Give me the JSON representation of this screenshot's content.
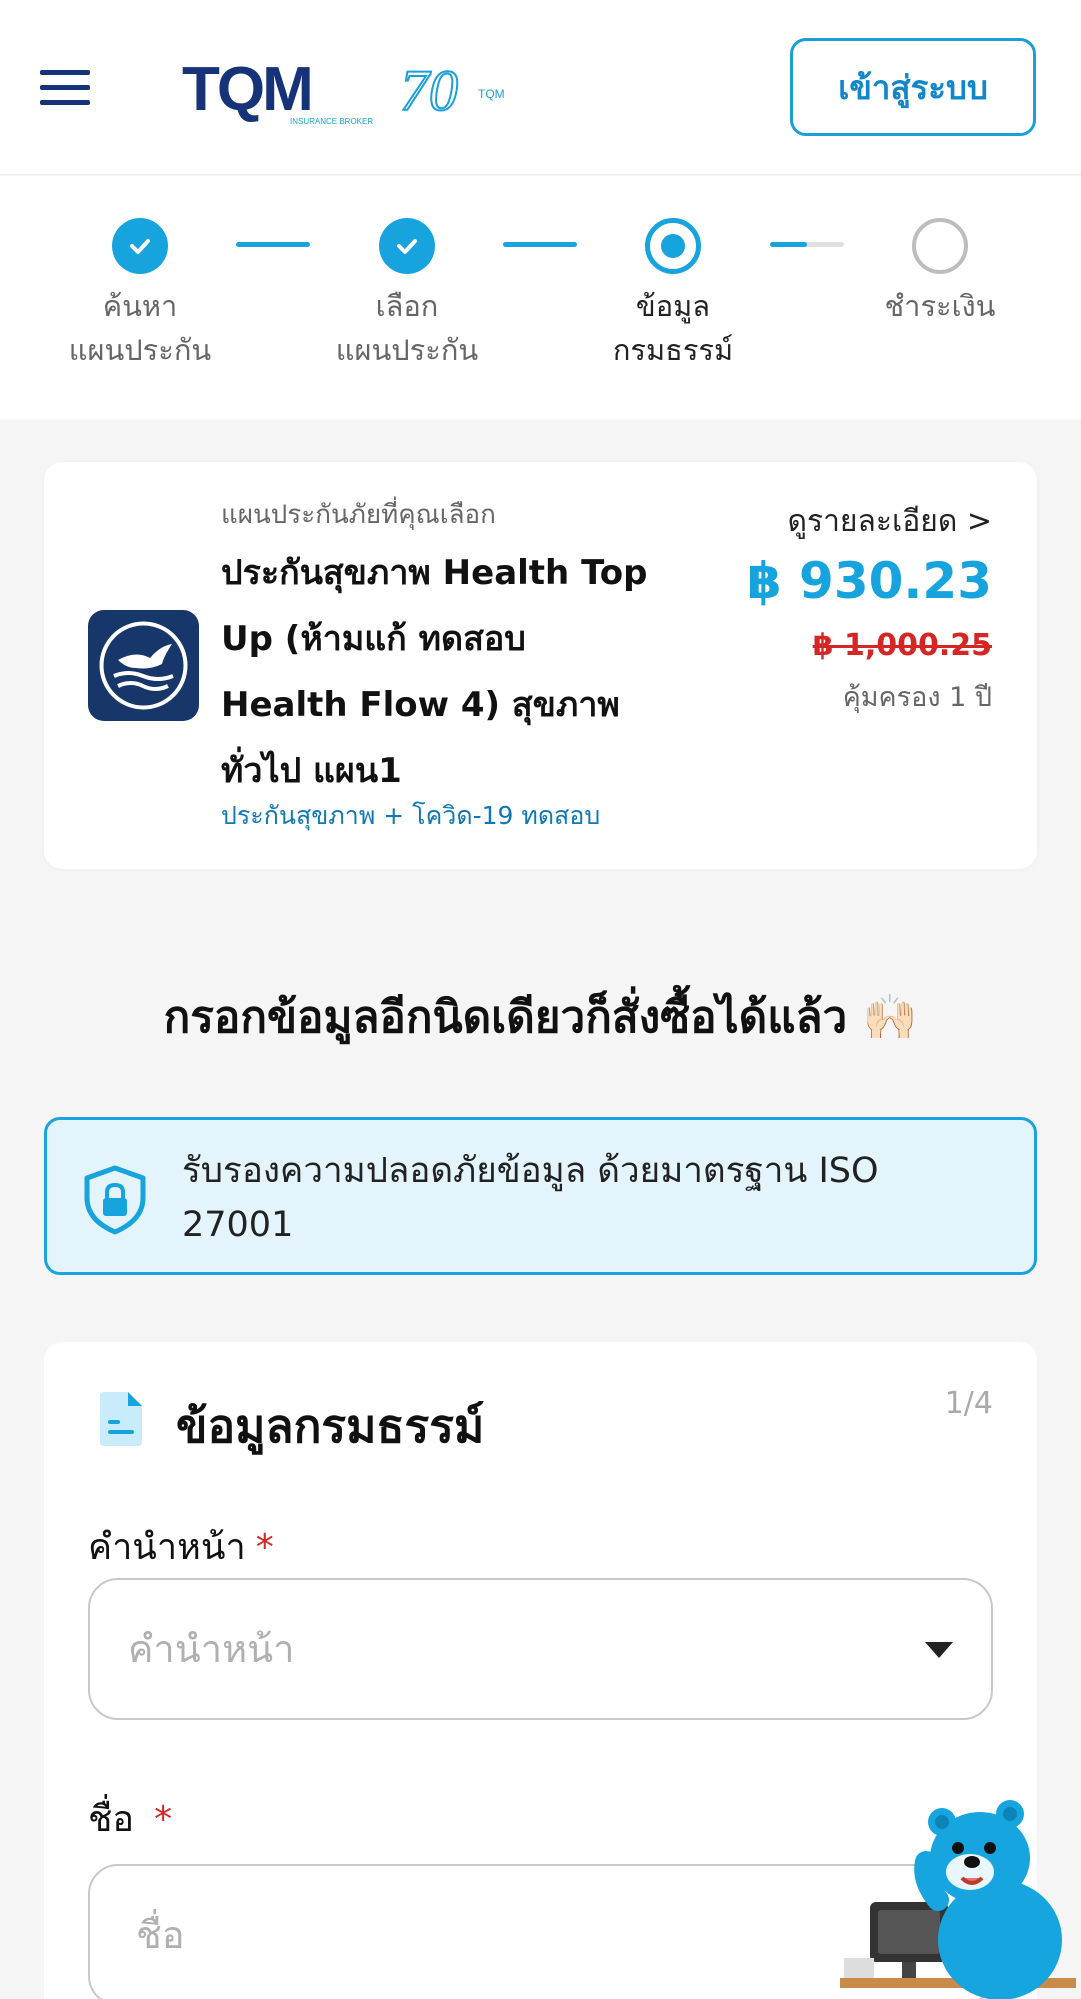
{
  "header": {
    "logo_text": "TQM",
    "logo_tagline": "INSURANCE BROKER",
    "anniversary_mark": "70",
    "anniversary_tag": "TQM",
    "login_label": "เข้าสู่ระบบ"
  },
  "stepper": {
    "steps": [
      {
        "line1": "ค้นหา",
        "line2": "แผนประกัน",
        "state": "done"
      },
      {
        "line1": "เลือก",
        "line2": "แผนประกัน",
        "state": "done"
      },
      {
        "line1": "ข้อมูล",
        "line2": "กรมธรรม์",
        "state": "current"
      },
      {
        "line1": "ชำระเงิน",
        "line2": "",
        "state": "pending"
      }
    ],
    "progress_last_connector": 0.5
  },
  "plan": {
    "caption": "แผนประกันภัยที่คุณเลือก",
    "name": "ประกันสุขภาพ Health Top Up (ห้ามแก้ ทดสอบ Health Flow 4) สุขภาพทั่วไป แผน1",
    "category": "ประกันสุขภาพ + โควิด-19 ทดสอบ",
    "detail_link": "ดูรายละเอียด >",
    "price": "฿ 930.23",
    "old_price": "฿ 1,000.25",
    "coverage": "คุ้มครอง 1 ปี"
  },
  "headline": "กรอกข้อมูลอีกนิดเดียวก็สั่งซื้อได้แล้ว 🙌🏻",
  "security": {
    "text": "รับรองความปลอดภัยข้อมูล ด้วยมาตรฐาน ISO 27001"
  },
  "form": {
    "title": "ข้อมูลกรมธรรม์",
    "step_indicator": "1/4",
    "fields": [
      {
        "label": "คำนำหน้า",
        "required_mark": "*",
        "placeholder": "คำนำหน้า",
        "type": "select"
      },
      {
        "label": "ชื่อ",
        "required_mark": "*",
        "placeholder": "ชื่อ",
        "type": "text"
      }
    ]
  },
  "colors": {
    "brand_blue": "#16a3de",
    "navy": "#16337a",
    "price_red": "#d52626"
  }
}
